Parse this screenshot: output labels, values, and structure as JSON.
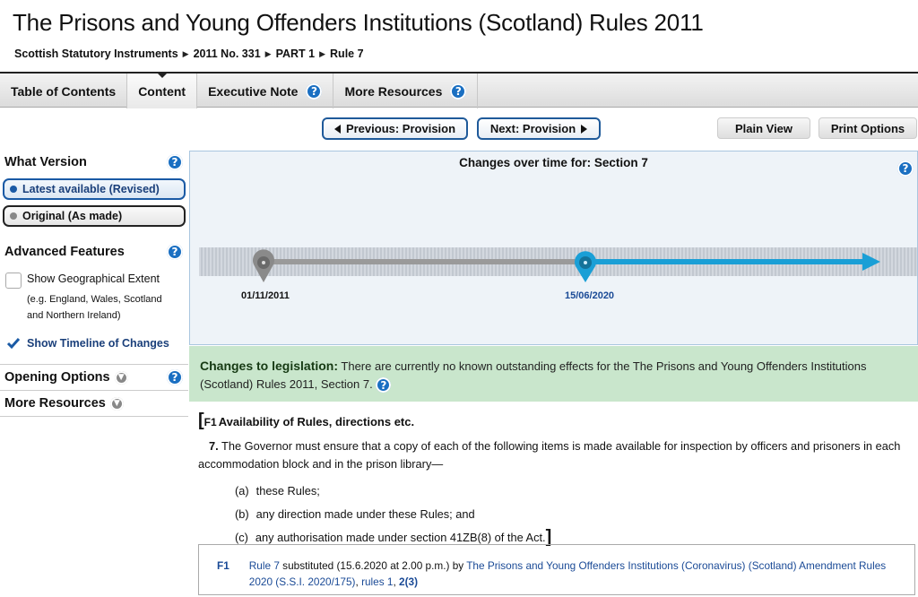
{
  "page": {
    "title": "The Prisons and Young Offenders Institutions (Scotland) Rules 2011",
    "breadcrumb": [
      "Scottish Statutory Instruments",
      "2011 No. 331",
      "PART 1",
      "Rule 7"
    ]
  },
  "tabs": [
    {
      "label": "Table of Contents",
      "help": false,
      "active": false
    },
    {
      "label": "Content",
      "help": false,
      "active": true
    },
    {
      "label": "Executive Note",
      "help": true,
      "active": false
    },
    {
      "label": "More Resources",
      "help": true,
      "active": false
    }
  ],
  "nav": {
    "previous": "Previous: Provision",
    "next": "Next: Provision",
    "plain_view": "Plain View",
    "print_options": "Print Options"
  },
  "sidebar": {
    "what_version": "What Version",
    "latest": "Latest available (Revised)",
    "original": "Original (As made)",
    "advanced_features": "Advanced Features",
    "geo_extent": "Show Geographical Extent",
    "geo_hint_line1": "(e.g. England, Wales, Scotland",
    "geo_hint_line2": "and Northern Ireland)",
    "show_timeline": "Show Timeline of Changes",
    "opening_options": "Opening Options",
    "more_resources": "More Resources"
  },
  "timeline": {
    "title": "Changes over time for: Section 7",
    "dates": [
      "01/11/2011",
      "15/06/2020"
    ],
    "colors": {
      "past": "#999999",
      "current": "#1a9fd6"
    }
  },
  "changes": {
    "heading": "Changes to legislation:",
    "text": "There are currently no known outstanding effects for the The Prisons and Young Offenders Institutions (Scotland) Rules 2011, Section 7."
  },
  "rule": {
    "open_bracket": "[",
    "footnote_ref": "F1",
    "heading": "Availability of Rules, directions etc.",
    "number": "7.",
    "text": "The Governor must ensure that a copy of each of the following items is made available for inspection by officers and prisoners in each accommodation block and in the prison library—",
    "items": [
      {
        "label": "(a)",
        "text": "these Rules;"
      },
      {
        "label": "(b)",
        "text": "any direction made under these Rules; and"
      },
      {
        "label": "(c)",
        "text": "any authorisation made under section 41ZB(8) of the Act."
      }
    ],
    "close_bracket": "]"
  },
  "footnote": {
    "label": "F1",
    "link1": "Rule 7",
    "text1": " substituted (15.6.2020 at 2.00 p.m.) by ",
    "link2": "The Prisons and Young Offenders Institutions (Coronavirus) (Scotland) Amendment Rules 2020 (S.S.I. 2020/175)",
    "sep": ", ",
    "link3": "rules 1",
    "sep2": ", ",
    "link4": "2(3)"
  },
  "colors": {
    "accent_blue": "#1a6fc2",
    "changes_bg": "#c9e6cc",
    "timeline_blue": "#1a9fd6"
  }
}
